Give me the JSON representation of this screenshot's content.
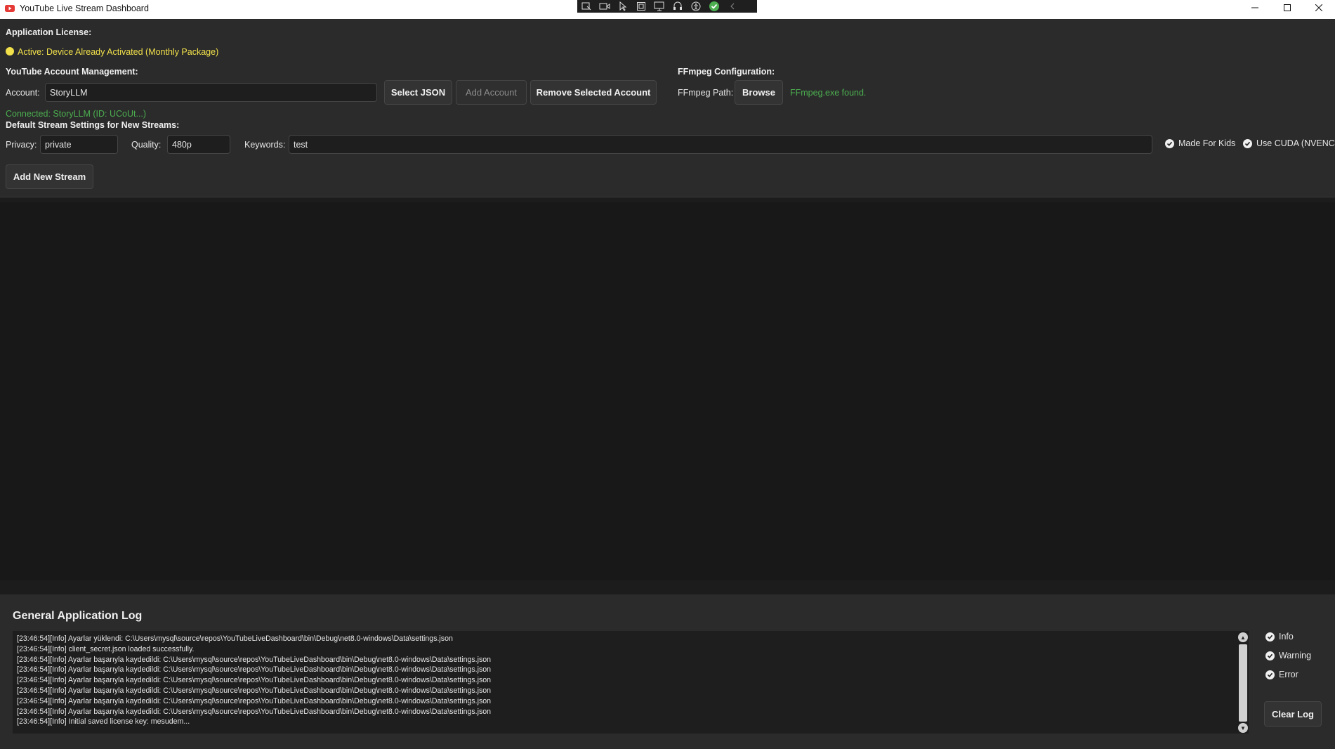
{
  "window": {
    "title": "YouTube Live Stream Dashboard",
    "capture_toolbar": [
      "snip-icon",
      "video-icon",
      "cursor-icon",
      "window-icon",
      "screen-icon",
      "audio-icon",
      "accessibility-icon",
      "check-icon",
      "collapse-icon"
    ]
  },
  "license": {
    "heading": "Application License:",
    "status": "Active: Device Already Activated (Monthly Package)",
    "status_color": "#f2e14a"
  },
  "account": {
    "heading": "YouTube Account Management:",
    "label": "Account:",
    "value": "StoryLLM",
    "select_json": "Select JSON",
    "add_account": "Add Account",
    "remove_account": "Remove Selected Account",
    "connected": "Connected: StoryLLM (ID: UCoUt...)"
  },
  "ffmpeg": {
    "heading": "FFmpeg Configuration:",
    "path_label": "FFmpeg Path:",
    "browse": "Browse",
    "status": "FFmpeg.exe found."
  },
  "defaults": {
    "heading": "Default Stream Settings for New Streams:",
    "privacy_label": "Privacy:",
    "privacy_value": "private",
    "quality_label": "Quality:",
    "quality_value": "480p",
    "keywords_label": "Keywords:",
    "keywords_value": "test",
    "made_for_kids": "Made For Kids",
    "use_cuda": "Use CUDA (NVENC)"
  },
  "add_stream": "Add New Stream",
  "log": {
    "title": "General Application Log",
    "lines": [
      "[23:46:54][Info] Ayarlar yüklendi: C:\\Users\\mysql\\source\\repos\\YouTubeLiveDashboard\\bin\\Debug\\net8.0-windows\\Data\\settings.json",
      "[23:46:54][Info] client_secret.json loaded successfully.",
      "[23:46:54][Info] Ayarlar başarıyla kaydedildi: C:\\Users\\mysql\\source\\repos\\YouTubeLiveDashboard\\bin\\Debug\\net8.0-windows\\Data\\settings.json",
      "[23:46:54][Info] Ayarlar başarıyla kaydedildi: C:\\Users\\mysql\\source\\repos\\YouTubeLiveDashboard\\bin\\Debug\\net8.0-windows\\Data\\settings.json",
      "[23:46:54][Info] Ayarlar başarıyla kaydedildi: C:\\Users\\mysql\\source\\repos\\YouTubeLiveDashboard\\bin\\Debug\\net8.0-windows\\Data\\settings.json",
      "[23:46:54][Info] Ayarlar başarıyla kaydedildi: C:\\Users\\mysql\\source\\repos\\YouTubeLiveDashboard\\bin\\Debug\\net8.0-windows\\Data\\settings.json",
      "[23:46:54][Info] Ayarlar başarıyla kaydedildi: C:\\Users\\mysql\\source\\repos\\YouTubeLiveDashboard\\bin\\Debug\\net8.0-windows\\Data\\settings.json",
      "[23:46:54][Info] Ayarlar başarıyla kaydedildi: C:\\Users\\mysql\\source\\repos\\YouTubeLiveDashboard\\bin\\Debug\\net8.0-windows\\Data\\settings.json",
      "[23:46:54][Info] Initial saved license key: mesudem..."
    ],
    "filters": [
      "Info",
      "Warning",
      "Error"
    ],
    "clear": "Clear Log"
  },
  "colors": {
    "success": "#4caf50",
    "warning": "#f2e14a",
    "panel": "#2b2b2b",
    "background": "#1c1c1c"
  }
}
